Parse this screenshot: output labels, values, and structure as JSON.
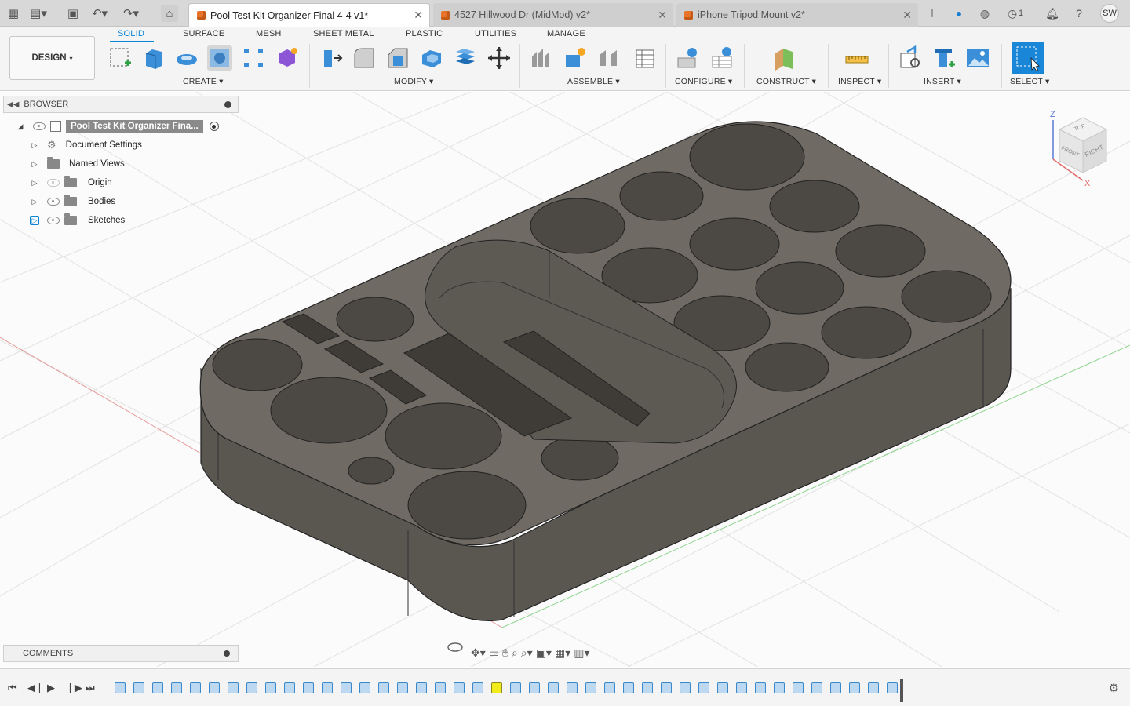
{
  "tabs": [
    {
      "title": "Pool Test Kit Organizer Final 4-4 v1*",
      "active": true
    },
    {
      "title": "4527 Hillwood Dr (MidMod) v2*",
      "active": false
    },
    {
      "title": "iPhone Tripod Mount v2*",
      "active": false
    }
  ],
  "topbar": {
    "job_count": "1",
    "user_initials": "SW"
  },
  "ribbon": {
    "workspace": "DESIGN",
    "tabs": [
      "SOLID",
      "SURFACE",
      "MESH",
      "SHEET METAL",
      "PLASTIC",
      "UTILITIES",
      "MANAGE"
    ],
    "groups": [
      "CREATE",
      "MODIFY",
      "ASSEMBLE",
      "CONFIGURE",
      "CONSTRUCT",
      "INSPECT",
      "INSERT",
      "SELECT"
    ]
  },
  "browser": {
    "title": "BROWSER",
    "root": "Pool Test Kit Organizer Fina...",
    "items": [
      "Document Settings",
      "Named Views",
      "Origin",
      "Bodies",
      "Sketches"
    ]
  },
  "comments": {
    "title": "COMMENTS"
  },
  "viewcube": {
    "top": "TOP",
    "front": "FRONT",
    "right": "RIGHT",
    "z": "Z",
    "x": "X"
  },
  "colors": {
    "accent": "#0a84d6",
    "model_top": "#6f6a63",
    "model_side": "#5a5650"
  }
}
